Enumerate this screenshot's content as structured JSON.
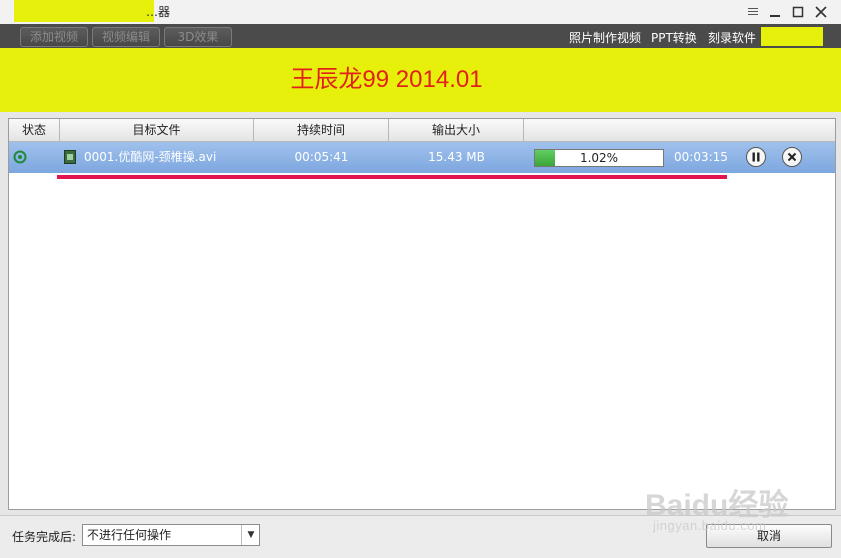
{
  "window": {
    "title": "…器",
    "controls": {
      "menu_icon": "menu-icon",
      "minimize_icon": "minimize-icon",
      "maximize_icon": "maximize-icon",
      "close_icon": "close-icon"
    }
  },
  "toolbar": {
    "add_video": "添加视频",
    "video_edit": "视频编辑",
    "effects_3d": "3D效果",
    "links": [
      "照片制作视频",
      "PPT转换",
      "刻录软件"
    ]
  },
  "banner": {
    "text": "王辰龙99 2014.01",
    "bg_color": "#e6f00a",
    "text_color": "#e2211c"
  },
  "table": {
    "headers": [
      "状态",
      "目标文件",
      "持续时间",
      "输出大小",
      ""
    ],
    "rows": [
      {
        "status_icon": "converting-icon",
        "file_icon": "film-icon",
        "file": "0001.优酷网-颈椎操.avi",
        "duration": "00:05:41",
        "size": "15.43 MB",
        "progress": 0.0102,
        "progress_text": "1.02%",
        "remaining": "00:03:15",
        "pause_icon": "pause-icon",
        "cancel_icon": "close-circle-icon"
      }
    ],
    "row_highlight_color": "#8fb4e6",
    "underline_color": "#e2144f"
  },
  "footer": {
    "after_task_label": "任务完成后:",
    "after_task_value": "不进行任何操作",
    "cancel_button": "取消"
  },
  "watermark": {
    "logo": "Baidu经验",
    "sub": "jingyan.baidu.com"
  }
}
